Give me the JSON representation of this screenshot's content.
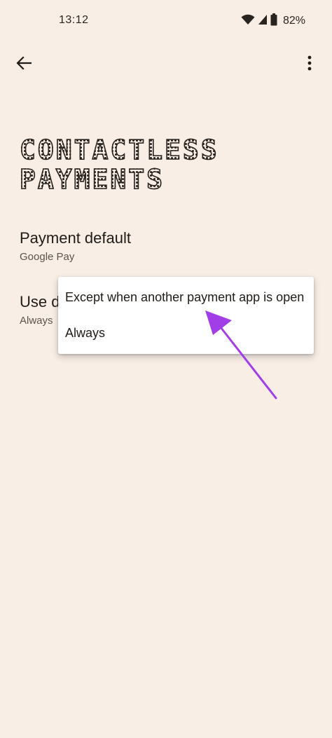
{
  "status_bar": {
    "time": "13:12",
    "battery_percent": "82%",
    "icons": [
      "wifi-icon",
      "signal-icon",
      "battery-icon"
    ]
  },
  "top_bar": {
    "back_icon": "back-arrow-icon",
    "more_icon": "more-vert-icon"
  },
  "page": {
    "title_line1": "CONTACTLESS",
    "title_line2": "PAYMENTS"
  },
  "preferences": {
    "payment_default": {
      "title": "Payment default",
      "summary": "Google Pay"
    },
    "use_default": {
      "title": "Use d",
      "summary": "Always"
    }
  },
  "popup_menu": {
    "options": [
      "Except when another payment app is open",
      "Always"
    ]
  },
  "colors": {
    "background": "#f8eee6",
    "menu_background": "#ffffff",
    "annotation_arrow": "#a23ee8",
    "text_primary": "#1f1b17",
    "text_secondary": "#5b524b"
  }
}
